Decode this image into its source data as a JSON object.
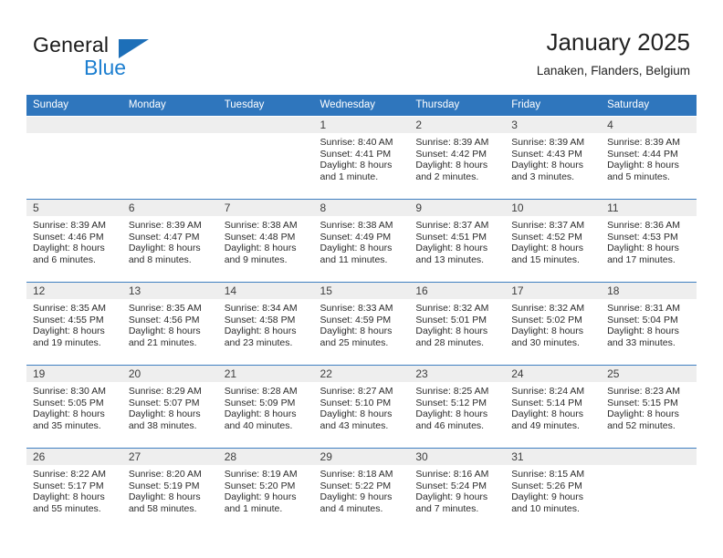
{
  "brand": {
    "name_top": "General",
    "name_bottom": "Blue",
    "triangle_color": "#1d6fb8",
    "blue_text_color": "#1d7fd0"
  },
  "header": {
    "title": "January 2025",
    "subtitle": "Lanaken, Flanders, Belgium"
  },
  "theme": {
    "header_row_bg": "#2f76bd",
    "header_row_text": "#ffffff",
    "daynum_band_bg": "#eeeeee",
    "week_divider": "#3f7fc1",
    "page_bg": "#ffffff"
  },
  "weekdays": [
    "Sunday",
    "Monday",
    "Tuesday",
    "Wednesday",
    "Thursday",
    "Friday",
    "Saturday"
  ],
  "labels": {
    "sunrise_prefix": "Sunrise:",
    "sunset_prefix": "Sunset:",
    "daylight_prefix": "Daylight:"
  },
  "weeks": [
    [
      {
        "day": "",
        "empty": true
      },
      {
        "day": "",
        "empty": true
      },
      {
        "day": "",
        "empty": true
      },
      {
        "day": "1",
        "sunrise": "Sunrise: 8:40 AM",
        "sunset": "Sunset: 4:41 PM",
        "daylight_line1": "Daylight: 8 hours",
        "daylight_line2": "and 1 minute."
      },
      {
        "day": "2",
        "sunrise": "Sunrise: 8:39 AM",
        "sunset": "Sunset: 4:42 PM",
        "daylight_line1": "Daylight: 8 hours",
        "daylight_line2": "and 2 minutes."
      },
      {
        "day": "3",
        "sunrise": "Sunrise: 8:39 AM",
        "sunset": "Sunset: 4:43 PM",
        "daylight_line1": "Daylight: 8 hours",
        "daylight_line2": "and 3 minutes."
      },
      {
        "day": "4",
        "sunrise": "Sunrise: 8:39 AM",
        "sunset": "Sunset: 4:44 PM",
        "daylight_line1": "Daylight: 8 hours",
        "daylight_line2": "and 5 minutes."
      }
    ],
    [
      {
        "day": "5",
        "sunrise": "Sunrise: 8:39 AM",
        "sunset": "Sunset: 4:46 PM",
        "daylight_line1": "Daylight: 8 hours",
        "daylight_line2": "and 6 minutes."
      },
      {
        "day": "6",
        "sunrise": "Sunrise: 8:39 AM",
        "sunset": "Sunset: 4:47 PM",
        "daylight_line1": "Daylight: 8 hours",
        "daylight_line2": "and 8 minutes."
      },
      {
        "day": "7",
        "sunrise": "Sunrise: 8:38 AM",
        "sunset": "Sunset: 4:48 PM",
        "daylight_line1": "Daylight: 8 hours",
        "daylight_line2": "and 9 minutes."
      },
      {
        "day": "8",
        "sunrise": "Sunrise: 8:38 AM",
        "sunset": "Sunset: 4:49 PM",
        "daylight_line1": "Daylight: 8 hours",
        "daylight_line2": "and 11 minutes."
      },
      {
        "day": "9",
        "sunrise": "Sunrise: 8:37 AM",
        "sunset": "Sunset: 4:51 PM",
        "daylight_line1": "Daylight: 8 hours",
        "daylight_line2": "and 13 minutes."
      },
      {
        "day": "10",
        "sunrise": "Sunrise: 8:37 AM",
        "sunset": "Sunset: 4:52 PM",
        "daylight_line1": "Daylight: 8 hours",
        "daylight_line2": "and 15 minutes."
      },
      {
        "day": "11",
        "sunrise": "Sunrise: 8:36 AM",
        "sunset": "Sunset: 4:53 PM",
        "daylight_line1": "Daylight: 8 hours",
        "daylight_line2": "and 17 minutes."
      }
    ],
    [
      {
        "day": "12",
        "sunrise": "Sunrise: 8:35 AM",
        "sunset": "Sunset: 4:55 PM",
        "daylight_line1": "Daylight: 8 hours",
        "daylight_line2": "and 19 minutes."
      },
      {
        "day": "13",
        "sunrise": "Sunrise: 8:35 AM",
        "sunset": "Sunset: 4:56 PM",
        "daylight_line1": "Daylight: 8 hours",
        "daylight_line2": "and 21 minutes."
      },
      {
        "day": "14",
        "sunrise": "Sunrise: 8:34 AM",
        "sunset": "Sunset: 4:58 PM",
        "daylight_line1": "Daylight: 8 hours",
        "daylight_line2": "and 23 minutes."
      },
      {
        "day": "15",
        "sunrise": "Sunrise: 8:33 AM",
        "sunset": "Sunset: 4:59 PM",
        "daylight_line1": "Daylight: 8 hours",
        "daylight_line2": "and 25 minutes."
      },
      {
        "day": "16",
        "sunrise": "Sunrise: 8:32 AM",
        "sunset": "Sunset: 5:01 PM",
        "daylight_line1": "Daylight: 8 hours",
        "daylight_line2": "and 28 minutes."
      },
      {
        "day": "17",
        "sunrise": "Sunrise: 8:32 AM",
        "sunset": "Sunset: 5:02 PM",
        "daylight_line1": "Daylight: 8 hours",
        "daylight_line2": "and 30 minutes."
      },
      {
        "day": "18",
        "sunrise": "Sunrise: 8:31 AM",
        "sunset": "Sunset: 5:04 PM",
        "daylight_line1": "Daylight: 8 hours",
        "daylight_line2": "and 33 minutes."
      }
    ],
    [
      {
        "day": "19",
        "sunrise": "Sunrise: 8:30 AM",
        "sunset": "Sunset: 5:05 PM",
        "daylight_line1": "Daylight: 8 hours",
        "daylight_line2": "and 35 minutes."
      },
      {
        "day": "20",
        "sunrise": "Sunrise: 8:29 AM",
        "sunset": "Sunset: 5:07 PM",
        "daylight_line1": "Daylight: 8 hours",
        "daylight_line2": "and 38 minutes."
      },
      {
        "day": "21",
        "sunrise": "Sunrise: 8:28 AM",
        "sunset": "Sunset: 5:09 PM",
        "daylight_line1": "Daylight: 8 hours",
        "daylight_line2": "and 40 minutes."
      },
      {
        "day": "22",
        "sunrise": "Sunrise: 8:27 AM",
        "sunset": "Sunset: 5:10 PM",
        "daylight_line1": "Daylight: 8 hours",
        "daylight_line2": "and 43 minutes."
      },
      {
        "day": "23",
        "sunrise": "Sunrise: 8:25 AM",
        "sunset": "Sunset: 5:12 PM",
        "daylight_line1": "Daylight: 8 hours",
        "daylight_line2": "and 46 minutes."
      },
      {
        "day": "24",
        "sunrise": "Sunrise: 8:24 AM",
        "sunset": "Sunset: 5:14 PM",
        "daylight_line1": "Daylight: 8 hours",
        "daylight_line2": "and 49 minutes."
      },
      {
        "day": "25",
        "sunrise": "Sunrise: 8:23 AM",
        "sunset": "Sunset: 5:15 PM",
        "daylight_line1": "Daylight: 8 hours",
        "daylight_line2": "and 52 minutes."
      }
    ],
    [
      {
        "day": "26",
        "sunrise": "Sunrise: 8:22 AM",
        "sunset": "Sunset: 5:17 PM",
        "daylight_line1": "Daylight: 8 hours",
        "daylight_line2": "and 55 minutes."
      },
      {
        "day": "27",
        "sunrise": "Sunrise: 8:20 AM",
        "sunset": "Sunset: 5:19 PM",
        "daylight_line1": "Daylight: 8 hours",
        "daylight_line2": "and 58 minutes."
      },
      {
        "day": "28",
        "sunrise": "Sunrise: 8:19 AM",
        "sunset": "Sunset: 5:20 PM",
        "daylight_line1": "Daylight: 9 hours",
        "daylight_line2": "and 1 minute."
      },
      {
        "day": "29",
        "sunrise": "Sunrise: 8:18 AM",
        "sunset": "Sunset: 5:22 PM",
        "daylight_line1": "Daylight: 9 hours",
        "daylight_line2": "and 4 minutes."
      },
      {
        "day": "30",
        "sunrise": "Sunrise: 8:16 AM",
        "sunset": "Sunset: 5:24 PM",
        "daylight_line1": "Daylight: 9 hours",
        "daylight_line2": "and 7 minutes."
      },
      {
        "day": "31",
        "sunrise": "Sunrise: 8:15 AM",
        "sunset": "Sunset: 5:26 PM",
        "daylight_line1": "Daylight: 9 hours",
        "daylight_line2": "and 10 minutes."
      },
      {
        "day": "",
        "empty": true
      }
    ]
  ]
}
